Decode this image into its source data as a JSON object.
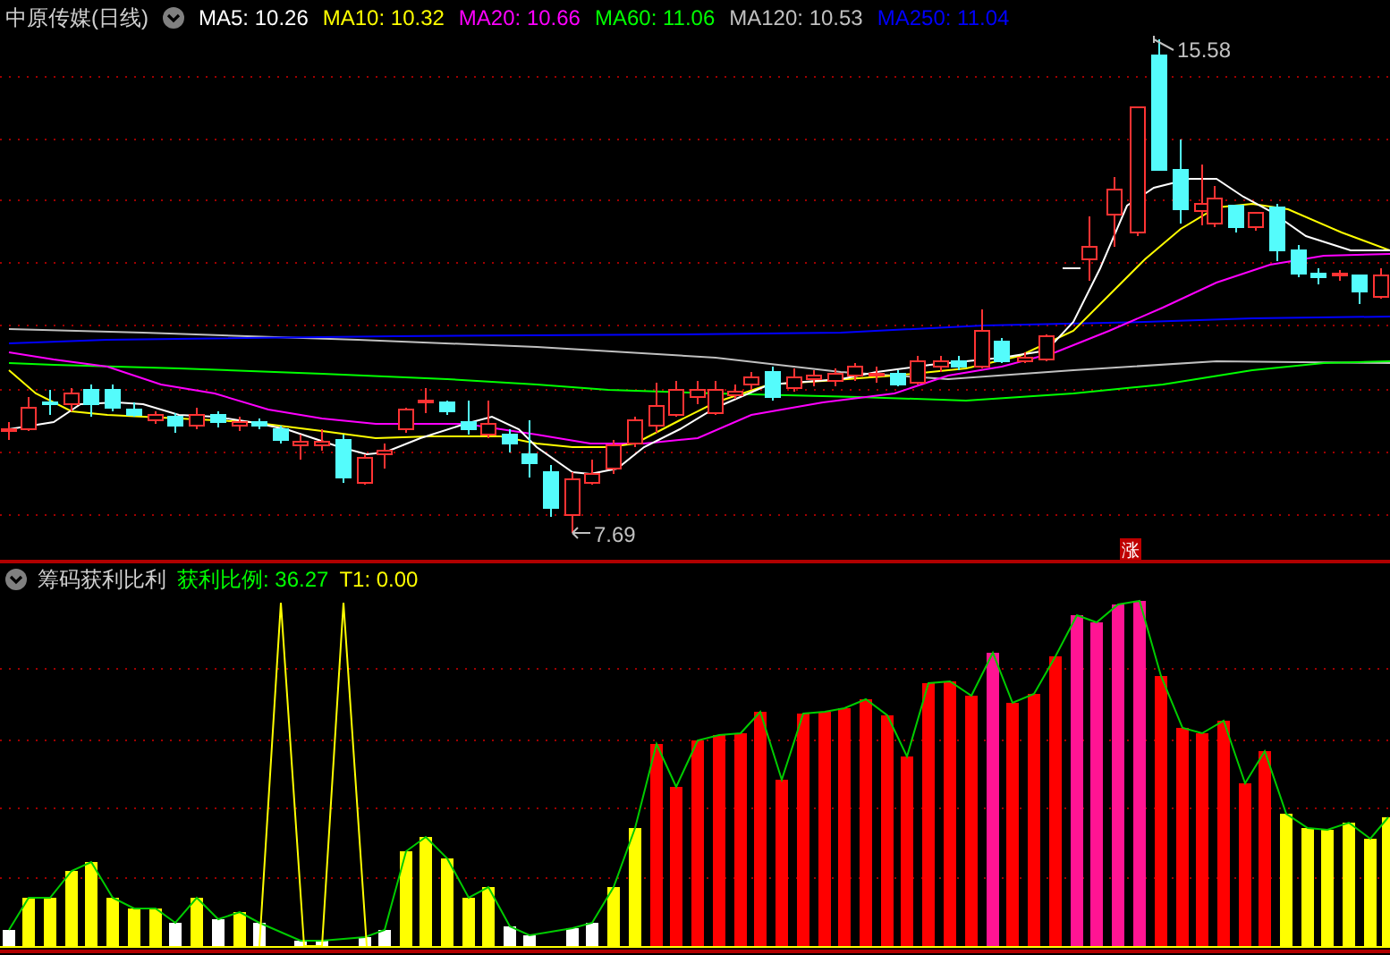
{
  "main_panel": {
    "title": "中原传媒(日线)",
    "indicators": [
      {
        "label": "MA5: 10.26",
        "color": "#ffffff"
      },
      {
        "label": "MA10: 10.32",
        "color": "#ffff00"
      },
      {
        "label": "MA20: 10.66",
        "color": "#ff00ff"
      },
      {
        "label": "MA60: 11.06",
        "color": "#00ff00"
      },
      {
        "label": "MA120: 10.53",
        "color": "#c0c0c0"
      },
      {
        "label": "MA250: 11.04",
        "color": "#0000ff"
      }
    ],
    "high_label": "15.58",
    "low_label": "7.69",
    "badge": "涨"
  },
  "sub_panel": {
    "title": "筹码获利比利",
    "values": [
      {
        "label": "获利比例: 36.27",
        "color": "#00ff00"
      },
      {
        "label": "T1: 0.00",
        "color": "#ffff00"
      }
    ]
  }
}
